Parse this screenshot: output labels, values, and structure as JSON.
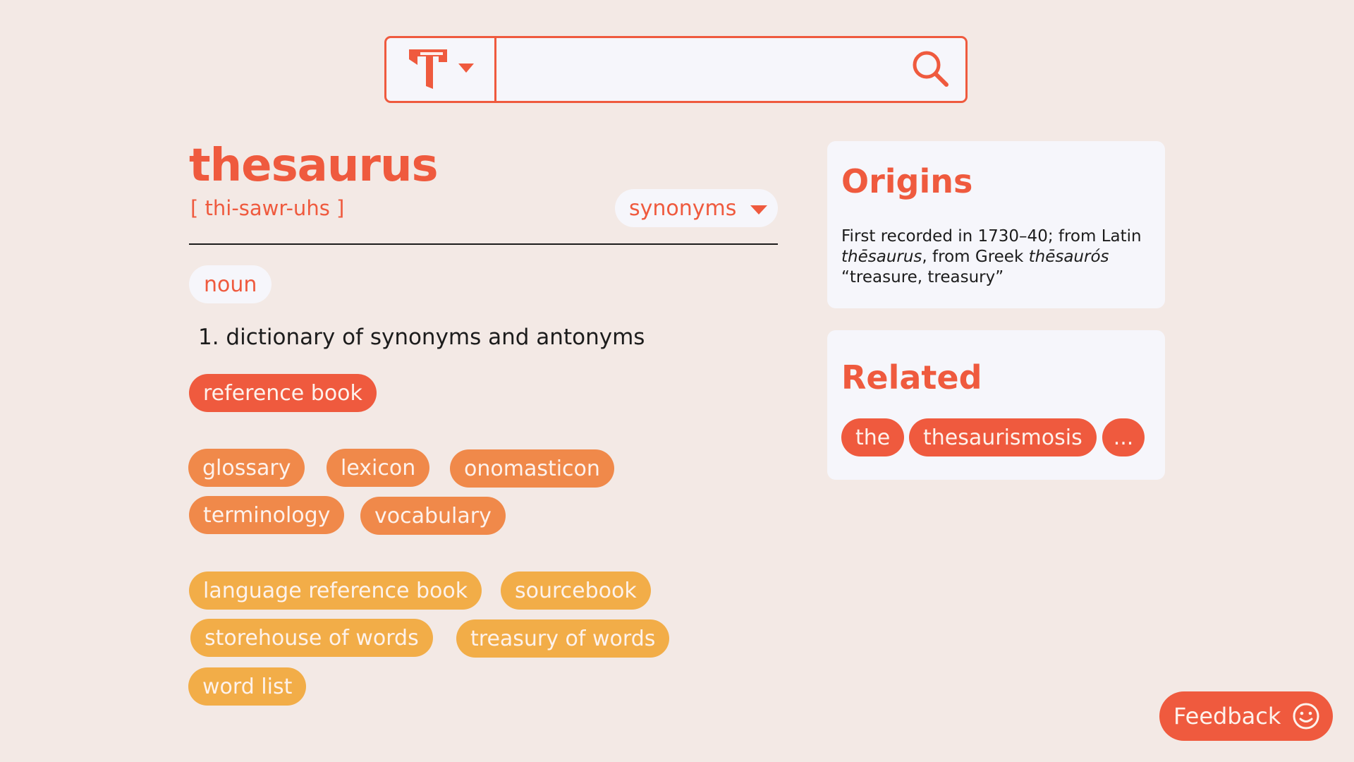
{
  "search": {
    "logo_icon": "t-logo-icon",
    "dropdown_icon": "caret-down-icon",
    "input_value": "",
    "search_icon": "search-icon"
  },
  "entry": {
    "headword": "thesaurus",
    "pronunciation": "[ thi-sawr-uhs ]",
    "view_selector": "synonyms",
    "part_of_speech": "noun",
    "definition": "1. dictionary of synonyms and antonyms",
    "strongest_match": [
      "reference book"
    ],
    "strong_matches": [
      "glossary",
      "lexicon",
      "onomasticon",
      "terminology",
      "vocabulary"
    ],
    "weak_matches": [
      "language reference book",
      "sourcebook",
      "storehouse of words",
      "treasury of words",
      "word list"
    ]
  },
  "origins": {
    "title": "Origins",
    "text_1": "First recorded in 1730–40; from Latin",
    "term_latin": "thēsaurus",
    "text_2": ", from Greek ",
    "term_greek": "thēsaurós",
    "text_3": "“treasure, treasury”"
  },
  "related": {
    "title": "Related",
    "items": [
      "the",
      "thesaurismosis",
      "..."
    ]
  },
  "feedback": {
    "label": "Feedback",
    "icon": "smiley-icon"
  },
  "colors": {
    "accent": "#ef5a3e",
    "strong": "#f0894a",
    "weak": "#f2ad48",
    "background": "#f3e9e5",
    "card": "#f6f6fb"
  }
}
